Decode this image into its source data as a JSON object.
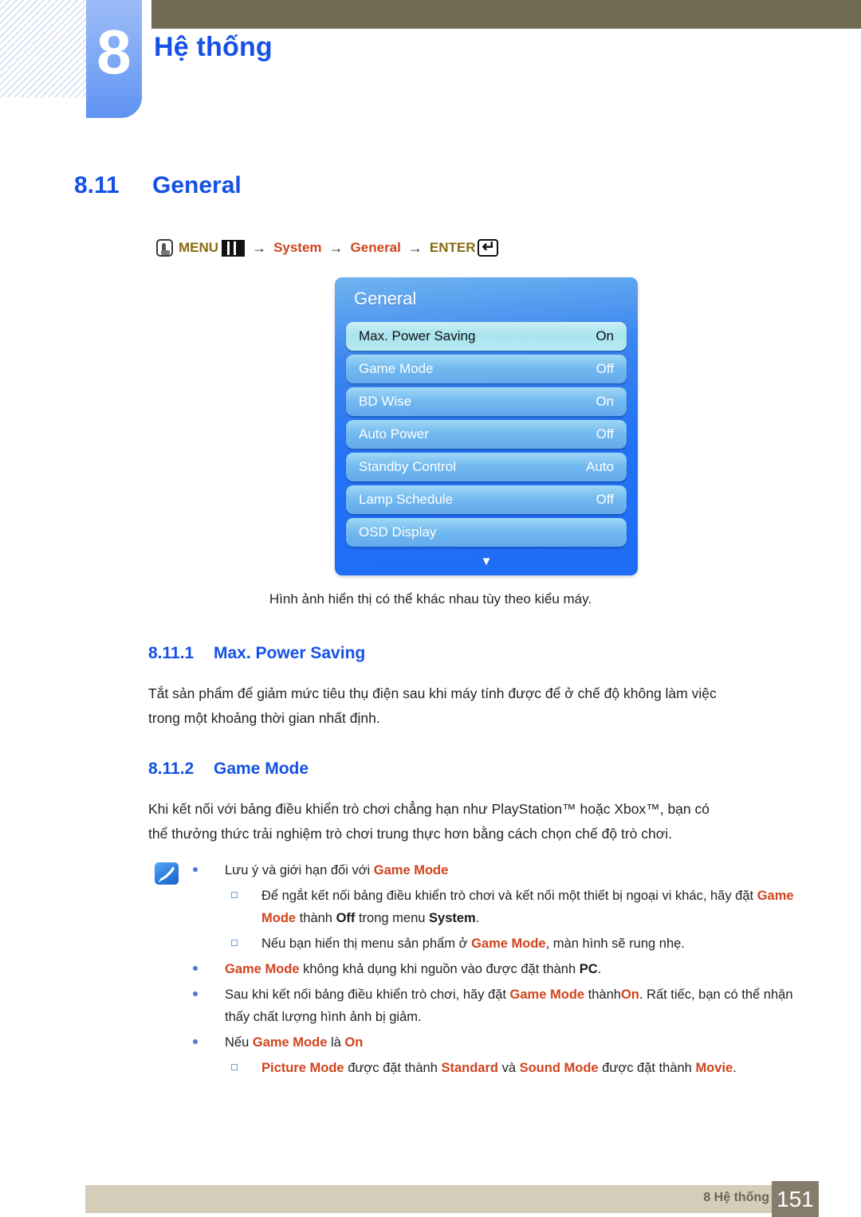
{
  "header": {
    "chapter_number": "8",
    "chapter_title": "Hệ thống"
  },
  "section": {
    "number": "8.11",
    "title": "General"
  },
  "menu_path": {
    "hand_icon": "hand-pointer-icon",
    "menu_label": "MENU",
    "menu_icon": "menu-bars-icon",
    "arrow1": "→",
    "step1": "System",
    "arrow2": "→",
    "step2": "General",
    "arrow3": "→",
    "enter_label": "ENTER",
    "enter_icon": "enter-return-icon"
  },
  "osd": {
    "title": "General",
    "rows": [
      {
        "label": "Max. Power Saving",
        "value": "On",
        "selected": true
      },
      {
        "label": "Game Mode",
        "value": "Off",
        "selected": false
      },
      {
        "label": "BD Wise",
        "value": "On",
        "selected": false
      },
      {
        "label": "Auto Power",
        "value": "Off",
        "selected": false
      },
      {
        "label": "Standby Control",
        "value": "Auto",
        "selected": false
      },
      {
        "label": "Lamp Schedule",
        "value": "Off",
        "selected": false
      },
      {
        "label": "OSD Display",
        "value": "",
        "selected": false
      }
    ],
    "scroll_down_icon": "chevron-down-icon"
  },
  "caption": "Hình ảnh hiển thị có thể khác nhau tùy theo kiểu máy.",
  "subsections": [
    {
      "number": "8.11.1",
      "title": "Max. Power Saving",
      "paragraph": "Tắt sản phẩm để giảm mức tiêu thụ điện sau khi máy tính được để ở chế độ không làm việc trong một khoảng thời gian nhất định."
    },
    {
      "number": "8.11.2",
      "title": "Game Mode",
      "paragraph": "Khi kết nối với bảng điều khiển trò chơi chẳng hạn như PlayStation™ hoặc Xbox™, bạn có thể thưởng thức trải nghiệm trò chơi trung thực hơn bằng cách chọn chế độ trò chơi."
    }
  ],
  "notes": {
    "icon": "note-pencil-icon",
    "items": [
      {
        "level": 1,
        "parts": [
          {
            "t": "Lưu ý và giới hạn đối với ",
            "s": "plain"
          },
          {
            "t": "Game Mode",
            "s": "red"
          }
        ]
      },
      {
        "level": 2,
        "parts": [
          {
            "t": "Để ngắt kết nối bảng điều khiển trò chơi và kết nối một thiết bị ngoại vi khác, hãy đặt ",
            "s": "plain"
          },
          {
            "t": "Game Mode",
            "s": "red"
          },
          {
            "t": " thành ",
            "s": "plain"
          },
          {
            "t": "Off",
            "s": "black-bold"
          },
          {
            "t": " trong menu ",
            "s": "plain"
          },
          {
            "t": "System",
            "s": "black-bold"
          },
          {
            "t": ".",
            "s": "plain"
          }
        ]
      },
      {
        "level": 2,
        "parts": [
          {
            "t": "Nếu bạn hiển thị menu sản phẩm ở ",
            "s": "plain"
          },
          {
            "t": "Game Mode",
            "s": "red"
          },
          {
            "t": ", màn hình sẽ rung nhẹ.",
            "s": "plain"
          }
        ]
      },
      {
        "level": 1,
        "parts": [
          {
            "t": "Game Mode",
            "s": "red"
          },
          {
            "t": " không khả dụng khi nguồn vào được đặt thành ",
            "s": "plain"
          },
          {
            "t": "PC",
            "s": "black-bold"
          },
          {
            "t": ".",
            "s": "plain"
          }
        ]
      },
      {
        "level": 1,
        "parts": [
          {
            "t": "Sau khi kết nối bảng điều khiển trò chơi, hãy đặt ",
            "s": "plain"
          },
          {
            "t": "Game Mode",
            "s": "red"
          },
          {
            "t": " thành",
            "s": "plain"
          },
          {
            "t": "On",
            "s": "red"
          },
          {
            "t": ". Rất tiếc, bạn có thể nhận thấy chất lượng hình ảnh bị giảm.",
            "s": "plain"
          }
        ]
      },
      {
        "level": 1,
        "parts": [
          {
            "t": "Nếu ",
            "s": "plain"
          },
          {
            "t": "Game Mode",
            "s": "red"
          },
          {
            "t": " là ",
            "s": "plain"
          },
          {
            "t": "On",
            "s": "red"
          }
        ]
      },
      {
        "level": 2,
        "parts": [
          {
            "t": "Picture Mode",
            "s": "red"
          },
          {
            "t": " được đặt thành ",
            "s": "plain"
          },
          {
            "t": "Standard",
            "s": "red"
          },
          {
            "t": " và ",
            "s": "plain"
          },
          {
            "t": "Sound Mode",
            "s": "red"
          },
          {
            "t": " được đặt thành ",
            "s": "plain"
          },
          {
            "t": "Movie",
            "s": "red"
          },
          {
            "t": ".",
            "s": "plain"
          }
        ]
      }
    ]
  },
  "footer": {
    "text": "8 Hệ thống",
    "page": "151"
  },
  "colors": {
    "heading_blue": "#1551e6",
    "olive": "#706a52",
    "accent_red": "#d1431d",
    "menu_brown": "#8a6a12",
    "footer_bar": "#d5cdb9",
    "page_block": "#857c6c"
  }
}
